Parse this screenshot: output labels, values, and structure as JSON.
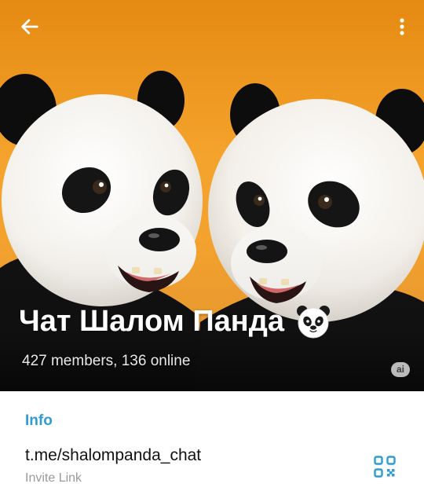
{
  "header": {
    "back_icon": "arrow-left-icon",
    "menu_icon": "more-vertical-icon"
  },
  "profile": {
    "title": "Чат Шалом Панда",
    "title_emoji_icon": "panda-face-icon",
    "subtitle": "427 members, 136 online",
    "ai_badge": "ai"
  },
  "info": {
    "section_title": "Info",
    "link_value": "t.me/shalompanda_chat",
    "link_label": "Invite Link",
    "qr_icon": "qr-code-icon"
  },
  "colors": {
    "accent": "#2f9dd0",
    "hero_background": "#f59e22",
    "title_text": "#ffffff",
    "link_text": "#111111",
    "secondary_text": "#9a9a9a"
  }
}
